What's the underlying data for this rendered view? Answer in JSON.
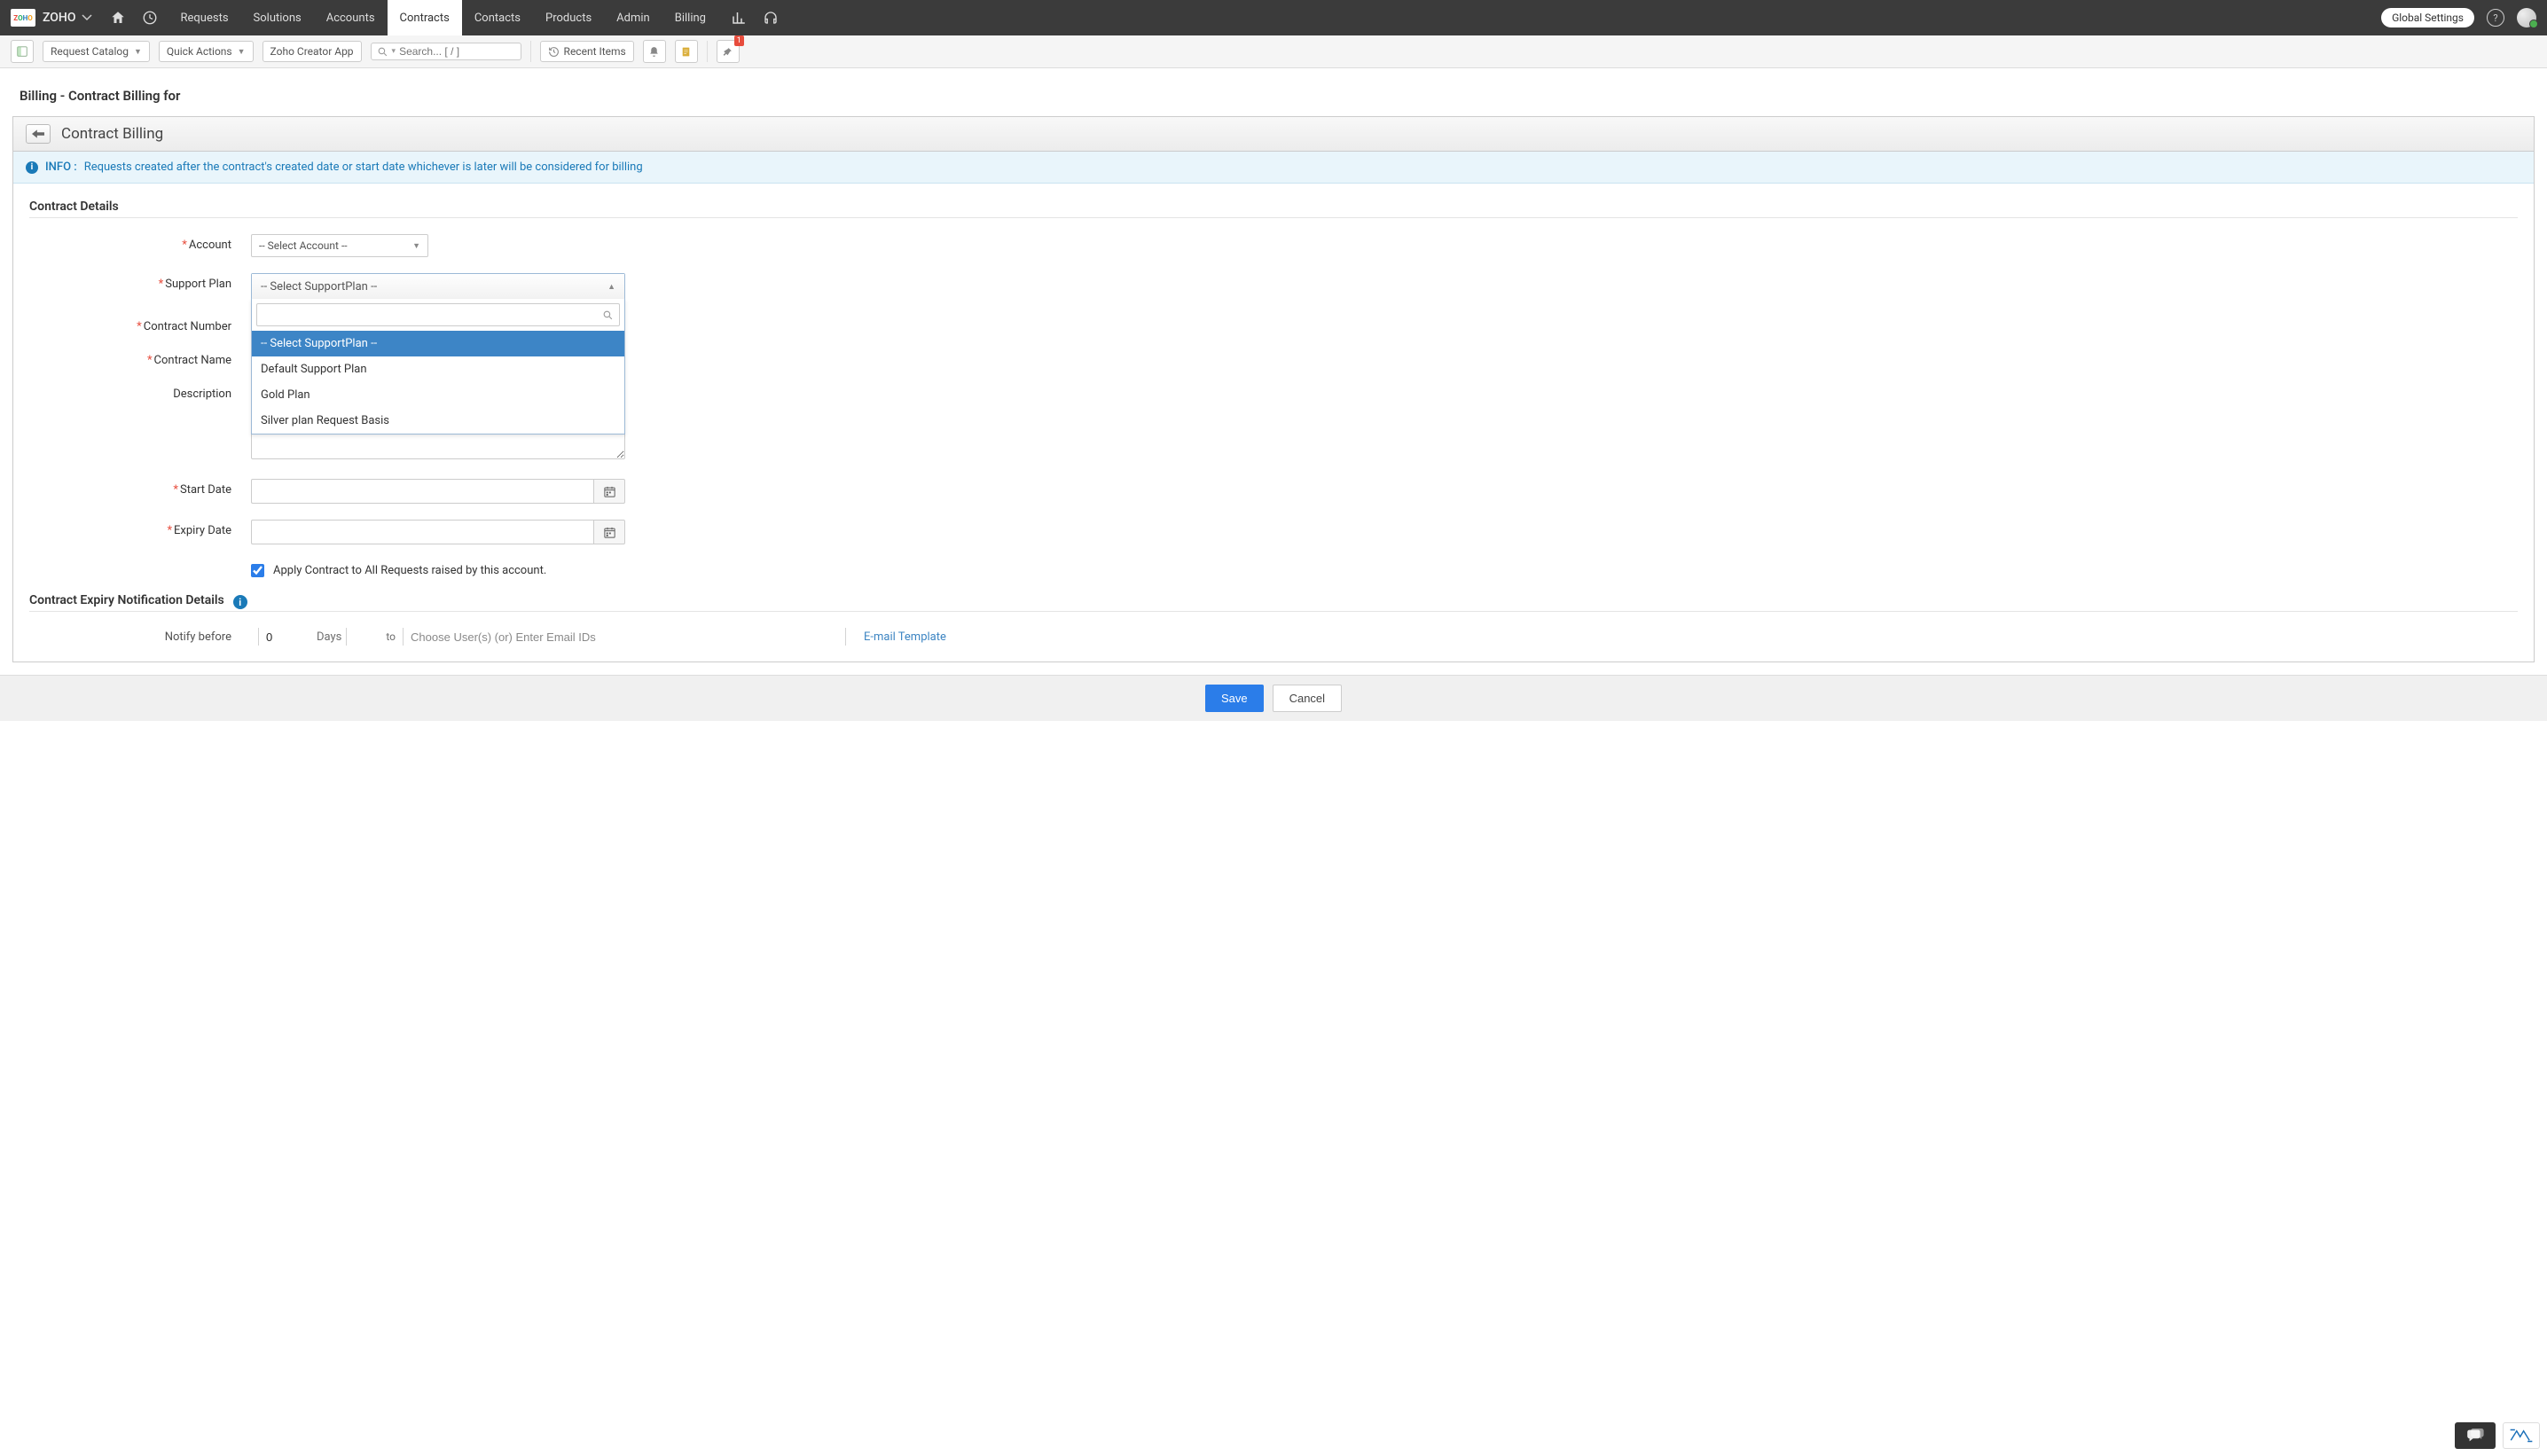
{
  "brand": "ZOHO",
  "topbar": {
    "tabs": [
      "Requests",
      "Solutions",
      "Accounts",
      "Contracts",
      "Contacts",
      "Products",
      "Admin",
      "Billing"
    ],
    "active_tab": "Contracts",
    "global_settings": "Global Settings"
  },
  "subbar": {
    "request_catalog": "Request Catalog",
    "quick_actions": "Quick Actions",
    "creator_app": "Zoho Creator App",
    "search_placeholder": "Search... [ / ]",
    "recent_items": "Recent Items",
    "pin_badge": "1"
  },
  "page": {
    "title": "Billing - Contract Billing for",
    "panel_title": "Contract Billing",
    "info_label": "INFO :",
    "info_text": "Requests created after the contract's created date or start date whichever is later will be considered for billing"
  },
  "form": {
    "section1_title": "Contract Details",
    "labels": {
      "account": "Account",
      "support_plan": "Support Plan",
      "contract_number": "Contract Number",
      "contract_name": "Contract Name",
      "description": "Description",
      "start_date": "Start Date",
      "expiry_date": "Expiry Date",
      "apply_all": "Apply Contract to All Requests raised by this account."
    },
    "account_select": "-- Select Account --",
    "support_plan_select": "-- Select SupportPlan --",
    "support_plan_options": [
      "-- Select SupportPlan --",
      "Default Support Plan",
      "Gold Plan",
      "Silver plan Request Basis"
    ],
    "apply_checked": true,
    "section2_title": "Contract Expiry Notification Details",
    "notify": {
      "label": "Notify before",
      "value": "0",
      "days": "Days",
      "to": "to",
      "email_placeholder": "Choose User(s) (or) Enter Email IDs",
      "template_link": "E-mail Template"
    }
  },
  "footer": {
    "save": "Save",
    "cancel": "Cancel"
  }
}
